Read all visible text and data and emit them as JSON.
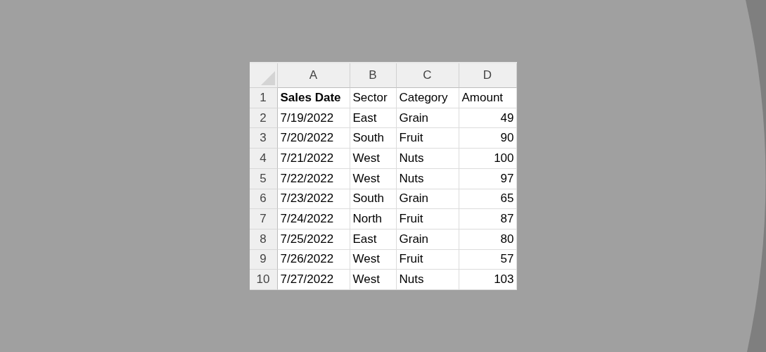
{
  "sheet": {
    "columns": [
      "A",
      "B",
      "C",
      "D"
    ],
    "rows": [
      {
        "number": "1",
        "cells": [
          {
            "text": "Sales Date",
            "bold": true
          },
          {
            "text": "Sector",
            "bold": false
          },
          {
            "text": "Category",
            "bold": false
          },
          {
            "text": "Amount",
            "bold": false
          }
        ]
      },
      {
        "number": "2",
        "cells": [
          {
            "text": "7/19/2022"
          },
          {
            "text": "East"
          },
          {
            "text": "Grain"
          },
          {
            "text": "49",
            "kind": "number"
          }
        ]
      },
      {
        "number": "3",
        "cells": [
          {
            "text": "7/20/2022"
          },
          {
            "text": "South"
          },
          {
            "text": "Fruit"
          },
          {
            "text": "90",
            "kind": "number"
          }
        ]
      },
      {
        "number": "4",
        "cells": [
          {
            "text": "7/21/2022"
          },
          {
            "text": "West"
          },
          {
            "text": "Nuts"
          },
          {
            "text": "100",
            "kind": "number"
          }
        ]
      },
      {
        "number": "5",
        "cells": [
          {
            "text": "7/22/2022"
          },
          {
            "text": "West"
          },
          {
            "text": "Nuts"
          },
          {
            "text": "97",
            "kind": "number"
          }
        ]
      },
      {
        "number": "6",
        "cells": [
          {
            "text": "7/23/2022"
          },
          {
            "text": "South"
          },
          {
            "text": "Grain"
          },
          {
            "text": "65",
            "kind": "number"
          }
        ]
      },
      {
        "number": "7",
        "cells": [
          {
            "text": "7/24/2022"
          },
          {
            "text": "North"
          },
          {
            "text": "Fruit"
          },
          {
            "text": "87",
            "kind": "number"
          }
        ]
      },
      {
        "number": "8",
        "cells": [
          {
            "text": "7/25/2022"
          },
          {
            "text": "East"
          },
          {
            "text": "Grain"
          },
          {
            "text": "80",
            "kind": "number"
          }
        ]
      },
      {
        "number": "9",
        "cells": [
          {
            "text": "7/26/2022"
          },
          {
            "text": "West"
          },
          {
            "text": "Fruit"
          },
          {
            "text": "57",
            "kind": "number"
          }
        ]
      },
      {
        "number": "10",
        "cells": [
          {
            "text": "7/27/2022"
          },
          {
            "text": "West"
          },
          {
            "text": "Nuts"
          },
          {
            "text": "103",
            "kind": "number"
          }
        ]
      }
    ]
  }
}
